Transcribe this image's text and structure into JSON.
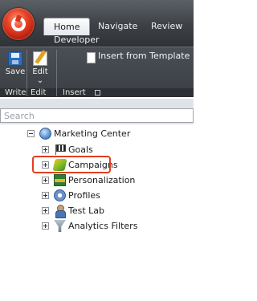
{
  "ribbon": {
    "tabs": [
      {
        "label": "Home",
        "active": true
      },
      {
        "label": "Navigate",
        "active": false
      },
      {
        "label": "Review",
        "active": false
      },
      {
        "label": "Developer",
        "active": false
      }
    ],
    "buttons": {
      "save": "Save",
      "edit": "Edit",
      "insert_from_template": "Insert from Template"
    },
    "group_captions": {
      "write": "Write",
      "edit": "Edit",
      "insert": "Insert"
    },
    "icons": {
      "app_menu": "application-orb-icon",
      "save": "save-disk-icon",
      "edit": "edit-pencil-icon",
      "insert": "document-icon",
      "launcher": "dialog-launcher-icon"
    }
  },
  "search": {
    "placeholder": "Search",
    "value": ""
  },
  "tree": {
    "root": {
      "label": "Marketing Center",
      "icon": "globe-icon",
      "expanded": true
    },
    "items": [
      {
        "label": "Goals",
        "icon": "checkered-flag-icon",
        "expanded": false,
        "highlighted": false
      },
      {
        "label": "Campaigns",
        "icon": "campaign-icon",
        "expanded": false,
        "highlighted": true
      },
      {
        "label": "Personalization",
        "icon": "personalization-icon",
        "expanded": false,
        "highlighted": false
      },
      {
        "label": "Profiles",
        "icon": "profile-icon",
        "expanded": false,
        "highlighted": false
      },
      {
        "label": "Test Lab",
        "icon": "test-lab-icon",
        "expanded": false,
        "highlighted": false
      },
      {
        "label": "Analytics Filters",
        "icon": "funnel-icon",
        "expanded": false,
        "highlighted": false
      }
    ]
  },
  "colors": {
    "ribbon_dark": "#3b3f44",
    "highlight_outline": "#e0401e",
    "search_band": "#dfe4ea"
  }
}
